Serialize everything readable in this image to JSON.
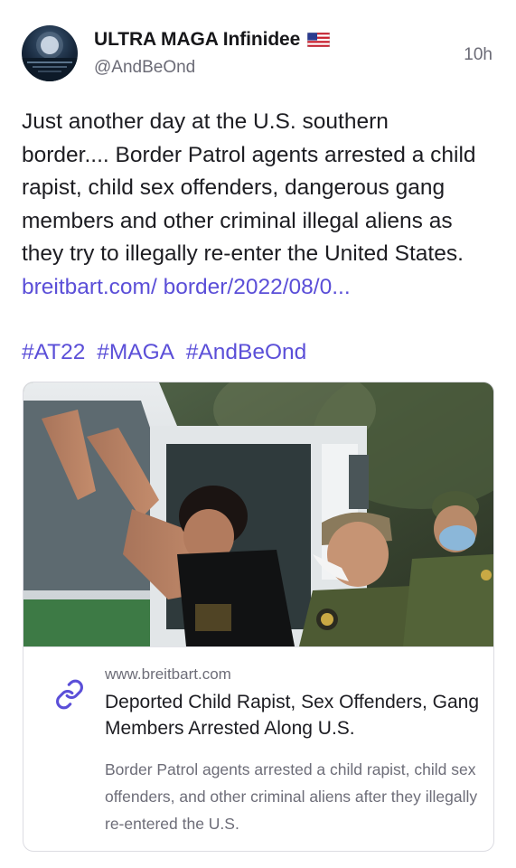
{
  "post": {
    "author": {
      "display_name": "ULTRA MAGA Infinidee",
      "flag": "US flag emoji",
      "handle": "@AndBeOnd"
    },
    "timestamp": "10h",
    "text_line1": "Just another day at the U.S. southern",
    "text_rest": "border.... Border Patrol agents arrested a child rapist, child sex offenders, dangerous gang members and other criminal illegal aliens as they try to illegally re-enter the United States. ",
    "link_text": "breitbart.com/ border/2022/08/0...",
    "hashtags": [
      "#AT22",
      "#MAGA",
      "#AndBeOnd"
    ]
  },
  "card": {
    "domain": "www.breitbart.com",
    "title": "Deported Child Rapist, Sex Offenders, Gang Members Arrested Along U.S.",
    "description": "Border Patrol agents arrested a child rapist, child sex offenders, and other criminal aliens after they illegally re-entered the U.S.",
    "link_icon": "link-icon"
  },
  "colors": {
    "accent": "#5b4fd8",
    "text": "#1d1d22",
    "muted": "#6d6d78",
    "border": "#dcdce2"
  }
}
